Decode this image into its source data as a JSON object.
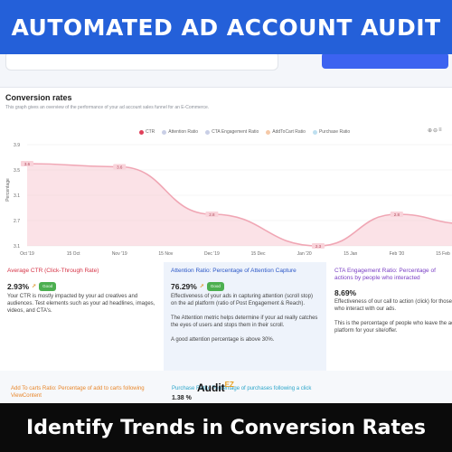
{
  "banner": {
    "title": "AUTOMATED AD ACCOUNT AUDIT",
    "bottom": "Identify Trends in Conversion Rates"
  },
  "section": {
    "title": "Conversion rates",
    "description": "This graph gives an overview of the performance of your ad account sales funnel for an E-Commerce."
  },
  "legend": [
    {
      "label": "CTR",
      "color": "#e0405a",
      "active": true
    },
    {
      "label": "Attention Ratio",
      "color": "#c9cfe6",
      "active": false
    },
    {
      "label": "CTA Engagement Ratio",
      "color": "#c9cfe6",
      "active": false
    },
    {
      "label": "AddToCart Ratio",
      "color": "#f5c9a8",
      "active": false
    },
    {
      "label": "Purchase Ratio",
      "color": "#bfe0f0",
      "active": false
    }
  ],
  "zoom_icons": [
    "zoom-in-icon",
    "zoom-out-icon",
    "menu-icon"
  ],
  "chart_data": {
    "type": "line",
    "ylabel": "Percentage",
    "yticks": [
      "3.9",
      "3.5",
      "3.1",
      "2.7",
      "3.1"
    ],
    "ylim": [
      2.3,
      3.9
    ],
    "xticks": [
      "Oct '19",
      "15 Oct",
      "Nov '19",
      "15 Nov",
      "Dec '19",
      "15 Dec",
      "Jan '20",
      "15 Jan",
      "Feb '20",
      "15 Feb"
    ],
    "series": [
      {
        "name": "CTR",
        "points": [
          {
            "x": 0,
            "y": 3.6,
            "label": "3.6"
          },
          {
            "x": 2,
            "y": 3.55,
            "label": "3.6"
          },
          {
            "x": 4,
            "y": 2.8,
            "label": "2.8"
          },
          {
            "x": 6.3,
            "y": 2.3,
            "label": "2.3"
          },
          {
            "x": 8,
            "y": 2.8,
            "label": "2.8"
          },
          {
            "x": 9.5,
            "y": 2.65
          }
        ]
      }
    ]
  },
  "cards": [
    {
      "title": "Average CTR (Click-Through Rate)",
      "value": "2.93%",
      "badge": "Good",
      "text1": "Your CTR is mostly impacted by your ad creatives and audiences. Test elements such as your ad headlines, images, videos, and CTA's.",
      "text2": "",
      "text3": ""
    },
    {
      "title": "Attention Ratio: Percentage of Attention Capture",
      "value": "76.29%",
      "badge": "Good",
      "text1": "Effectiveness of your ads in capturing attention (scroll stop) on the ad platform (ratio of Post Engagement & Reach).",
      "text2": "The Attention metric helps determine if your ad really catches the eyes of users and stops them in their scroll.",
      "text3": "A good attention percentage is above 30%."
    },
    {
      "title": "CTA Engagement Ratio: Percentage of actions by people who interacted",
      "value": "8.69%",
      "badge": "",
      "text1": "Effectiveness of our call to action (click) for those who interact with our ads.",
      "text2": "This is the percentage of people who leave the ad platform for your site/offer.",
      "text3": ""
    }
  ],
  "row2": [
    {
      "title": "Add To carts Ratio: Percentage of add to carts following ViewContent"
    },
    {
      "title": "Purchase Ratio: Percentage of purchases following a click",
      "value": "1.38 %"
    }
  ],
  "logo": {
    "text": "Audit",
    "sup": "EZ"
  }
}
